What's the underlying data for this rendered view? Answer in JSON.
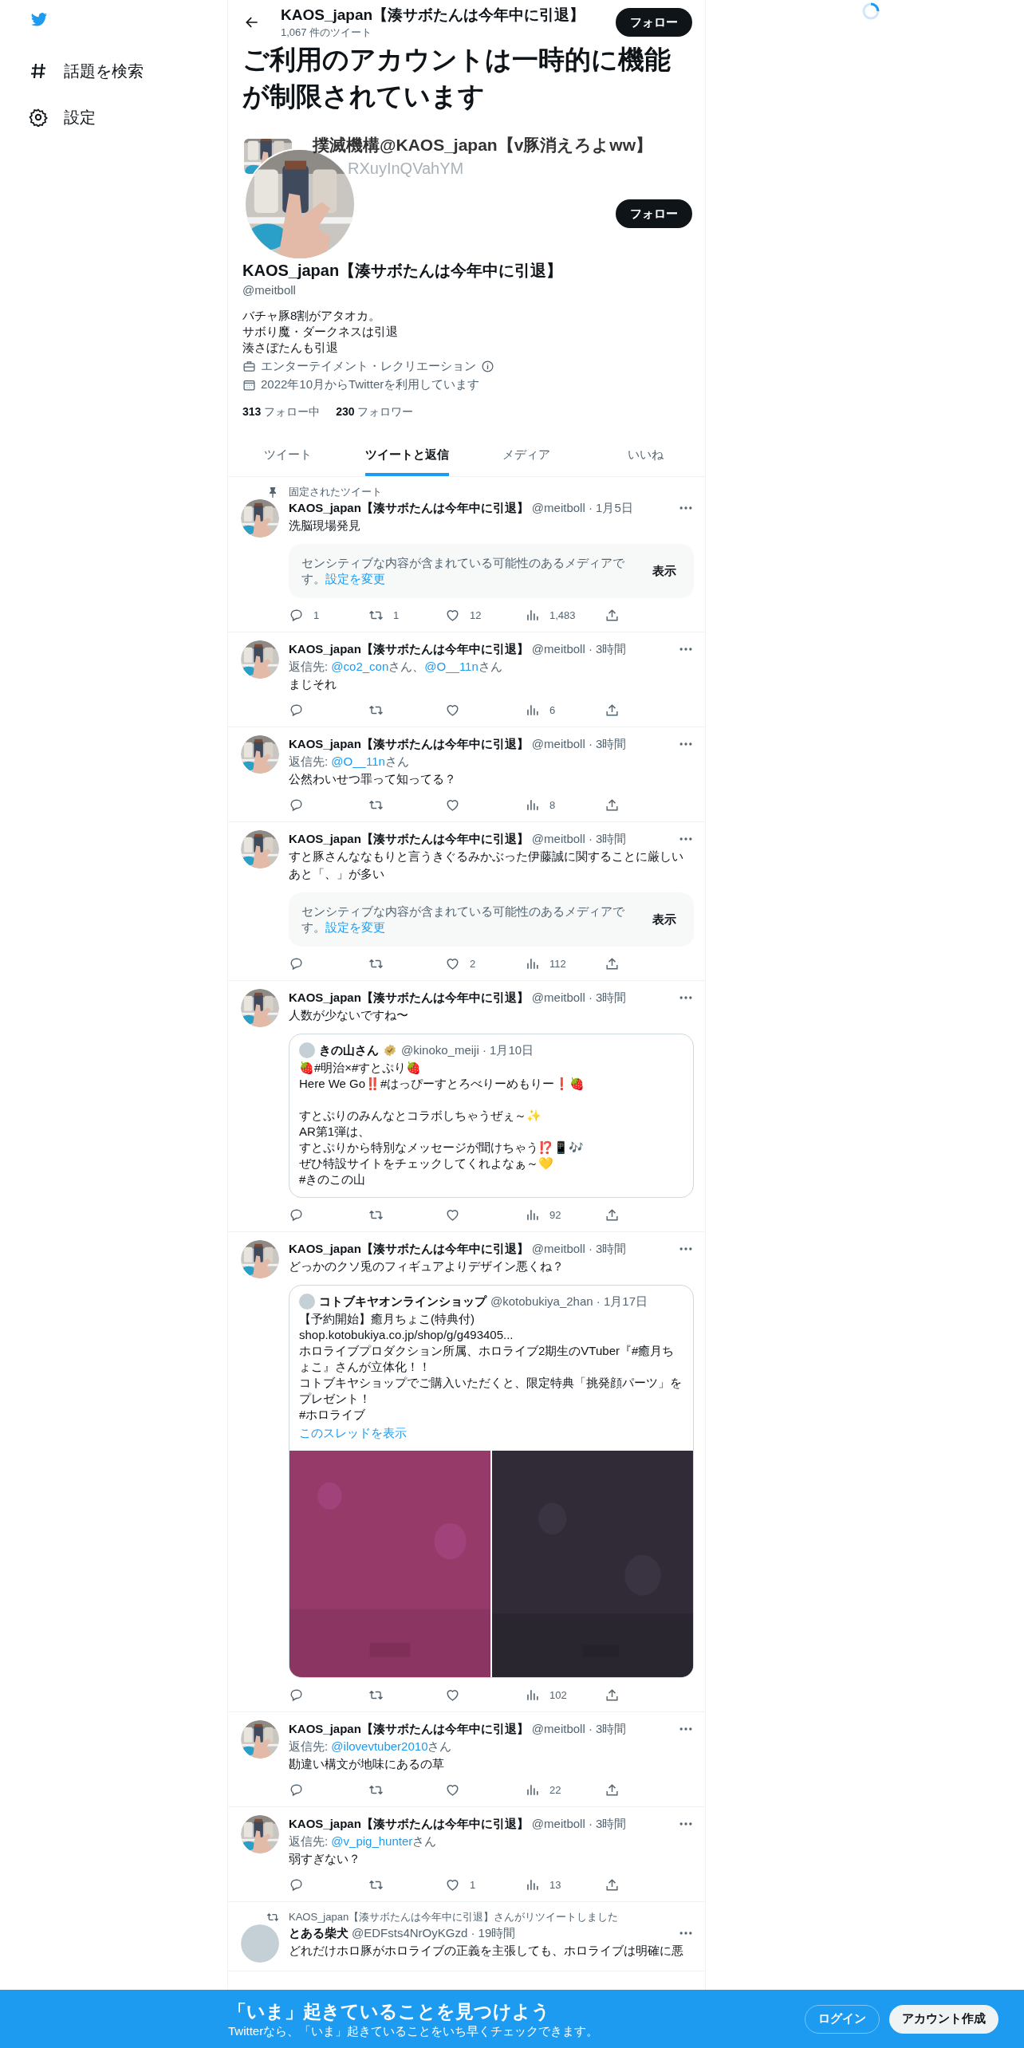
{
  "sidebar": {
    "items": [
      {
        "kind": "explore",
        "label": "話題を検索"
      },
      {
        "kind": "settings",
        "label": "設定"
      }
    ]
  },
  "header": {
    "title": "KAOS_japan【湊サボたんは今年中に引退】",
    "tweet_count": "1,067 件のツイート",
    "follow_button": "フォロー"
  },
  "notice": "ご利用のアカウントは一時的に機能が制限されています",
  "underlay": {
    "name": "撲滅機構@KAOS_japan【v豚消えろよww】",
    "handle": "RXuyInQVahYM"
  },
  "profile": {
    "follow_button": "フォロー",
    "name": "KAOS_japan【湊サボたんは今年中に引退】",
    "handle": "@meitboll",
    "bio": [
      "バチャ豚8割がアタオカ。",
      "サボり魔・ダークネスは引退",
      "湊さぼたんも引退"
    ],
    "category": "エンターテイメント・レクリエーション",
    "joined": "2022年10月からTwitterを利用しています",
    "following_count": "313",
    "following_label": "フォロー中",
    "followers_count": "230",
    "followers_label": "フォロワー"
  },
  "tabs": [
    {
      "label": "ツイート",
      "selected": false
    },
    {
      "label": "ツイートと返信",
      "selected": true
    },
    {
      "label": "メディア",
      "selected": false
    },
    {
      "label": "いいね",
      "selected": false
    }
  ],
  "tweets": [
    {
      "pinned_label": "固定されたツイート",
      "name": "KAOS_japan【湊サボたんは今年中に引退】",
      "meta": "@meitboll · 1月5日",
      "text": "洗脳現場発見",
      "media": {
        "kind": "sensitive",
        "notice": "センシティブな内容が含まれている可能性のあるメディアです。",
        "link": "設定を変更",
        "button": "表示"
      },
      "stats": [
        {
          "kind": "reply",
          "count": "1"
        },
        {
          "kind": "retweet",
          "count": "1"
        },
        {
          "kind": "like",
          "count": "12"
        },
        {
          "kind": "views",
          "count": "1,483"
        },
        {
          "kind": "share"
        }
      ]
    },
    {
      "name": "KAOS_japan【湊サボたんは今年中に引退】",
      "meta": "@meitboll · 3時間",
      "reply_to": {
        "label": "返信先:",
        "targets": [
          {
            "handle": "@co2_con",
            "suffix": "さん、"
          },
          {
            "handle": "@O__11n",
            "suffix": "さん"
          }
        ]
      },
      "text": "まじそれ",
      "stats": [
        {
          "kind": "reply"
        },
        {
          "kind": "retweet"
        },
        {
          "kind": "like"
        },
        {
          "kind": "views",
          "count": "6"
        },
        {
          "kind": "share"
        }
      ]
    },
    {
      "name": "KAOS_japan【湊サボたんは今年中に引退】",
      "meta": "@meitboll · 3時間",
      "reply_to": {
        "label": "返信先:",
        "targets": [
          {
            "handle": "@O__11n",
            "suffix": "さん"
          }
        ]
      },
      "text": "公然わいせつ罪って知ってる？",
      "stats": [
        {
          "kind": "reply"
        },
        {
          "kind": "retweet"
        },
        {
          "kind": "like"
        },
        {
          "kind": "views",
          "count": "8"
        },
        {
          "kind": "share"
        }
      ]
    },
    {
      "name": "KAOS_japan【湊サボたんは今年中に引退】",
      "meta": "@meitboll · 3時間",
      "text": "すと豚さんななもりと言うきぐるみかぶった伊藤誠に関することに厳しいあと「、」が多い",
      "media": {
        "kind": "sensitive",
        "notice": "センシティブな内容が含まれている可能性のあるメディアです。",
        "link": "設定を変更",
        "button": "表示"
      },
      "stats": [
        {
          "kind": "reply"
        },
        {
          "kind": "retweet"
        },
        {
          "kind": "like",
          "count": "2"
        },
        {
          "kind": "views",
          "count": "112"
        },
        {
          "kind": "share"
        }
      ]
    },
    {
      "name": "KAOS_japan【湊サボたんは今年中に引退】",
      "meta": "@meitboll · 3時間",
      "text": "人数が少ないですね〜",
      "media": {
        "kind": "quote",
        "name": "きの山さん",
        "verified": true,
        "meta": "@kinoko_meiji · 1月10日",
        "paragraphs": [
          [
            "🍓#明治×#すとぷり🍓",
            "Here We Go‼️#はっぴーすとろべりーめもりー❗🍓"
          ],
          [
            "すとぷりのみんなとコラボしちゃうぜぇ～✨",
            "AR第1弾は、",
            "すとぷりから特別なメッセージが聞けちゃう⁉️📱🎶",
            "ぜひ特設サイトをチェックしてくれよなぁ～💛",
            "#きのこの山"
          ]
        ]
      },
      "stats": [
        {
          "kind": "reply"
        },
        {
          "kind": "retweet"
        },
        {
          "kind": "like"
        },
        {
          "kind": "views",
          "count": "92"
        },
        {
          "kind": "share"
        }
      ]
    },
    {
      "name": "KAOS_japan【湊サボたんは今年中に引退】",
      "meta": "@meitboll · 3時間",
      "text": "どっかのクソ兎のフィギュアよりデザイン悪くね？",
      "media": {
        "kind": "quote",
        "name": "コトブキヤオンラインショップ",
        "verified": false,
        "meta": "@kotobukiya_2han · 1月17日",
        "paragraphs": [
          [
            "【予約開始】癒月ちょこ(特典付)",
            "shop.kotobukiya.co.jp/shop/g/g493405...",
            "ホロライブプロダクション所属、ホロライブ2期生のVTuber『#癒月ちょこ』さんが立体化！！",
            "コトブキヤショップでご購入いただくと、限定特典「挑発顔パーツ」をプレゼント！",
            "#ホロライブ"
          ]
        ],
        "thread_link": "このスレッドを表示"
      },
      "stats": [
        {
          "kind": "reply"
        },
        {
          "kind": "retweet"
        },
        {
          "kind": "like"
        },
        {
          "kind": "views",
          "count": "102"
        },
        {
          "kind": "share"
        }
      ]
    },
    {
      "name": "KAOS_japan【湊サボたんは今年中に引退】",
      "meta": "@meitboll · 3時間",
      "reply_to": {
        "label": "返信先:",
        "targets": [
          {
            "handle": "@ilovevtuber2010",
            "suffix": "さん"
          }
        ]
      },
      "text": "勘違い構文が地味にあるの草",
      "stats": [
        {
          "kind": "reply"
        },
        {
          "kind": "retweet"
        },
        {
          "kind": "like"
        },
        {
          "kind": "views",
          "count": "22"
        },
        {
          "kind": "share"
        }
      ]
    },
    {
      "name": "KAOS_japan【湊サボたんは今年中に引退】",
      "meta": "@meitboll · 3時間",
      "reply_to": {
        "label": "返信先:",
        "targets": [
          {
            "handle": "@v_pig_hunter",
            "suffix": "さん"
          }
        ]
      },
      "text": "弱すぎない？",
      "stats": [
        {
          "kind": "reply"
        },
        {
          "kind": "retweet"
        },
        {
          "kind": "like",
          "count": "1"
        },
        {
          "kind": "views",
          "count": "13"
        },
        {
          "kind": "share"
        }
      ]
    },
    {
      "retweeted_by": "KAOS_japan【湊サボたんは今年中に引退】さんがリツイートしました",
      "name": "とある柴犬",
      "meta": "@EDFsts4NrOyKGzd · 19時間",
      "text": "どれだけホロ豚がホロライブの正義を主張しても、ホロライブは明確に悪"
    }
  ],
  "bottom_bar": {
    "title": "「いま」起きていることを見つけよう",
    "subtitle": "Twitterなら、「いま」起きていることをいち早くチェックできます。",
    "login": "ログイン",
    "signup": "アカウント作成"
  }
}
